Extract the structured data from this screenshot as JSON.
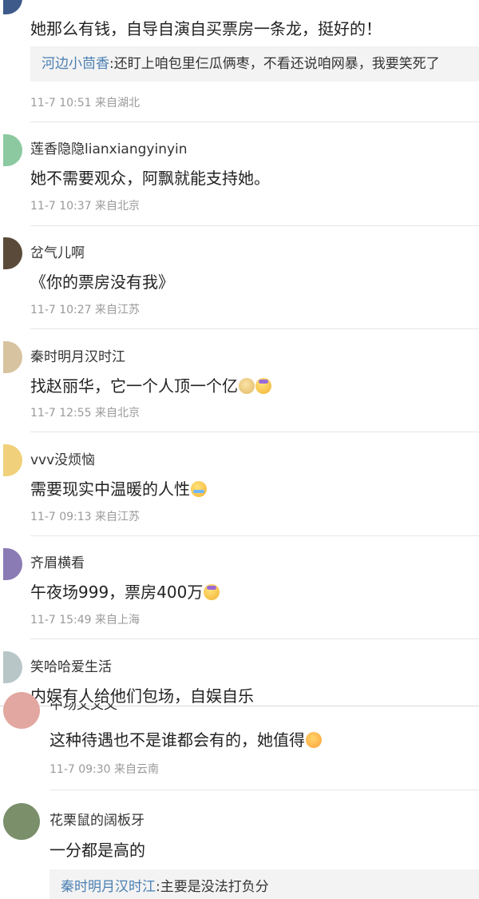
{
  "comments": [
    {
      "text": "她那么有钱，自导自演自买票房一条龙，挺好的！",
      "reply": {
        "name": "河边小茴香",
        "text": ":还盯上咱包里仨瓜俩枣，不看还说咱网暴，我要笑死了"
      },
      "meta": "11-7 10:51 来自湖北",
      "avatar_color": "#3d5a8a"
    },
    {
      "user": "莲香隐隐lianxiangyinyin",
      "text": "她不需要观众，阿飘就能支持她。",
      "meta": "11-7 10:37 来自北京",
      "avatar_color": "#8cc9a0"
    },
    {
      "user": "岔气儿啊",
      "text": "《你的票房没有我》",
      "meta": "11-7 10:27 来自江苏",
      "avatar_color": "#5a4a3a"
    },
    {
      "user": "秦时明月汉时江",
      "text": "找赵丽华，它一个人顶一个亿",
      "emojis": [
        "doge-emoji",
        "fear-emoji"
      ],
      "meta": "11-7 12:55 来自北京",
      "avatar_color": "#d8c3a0"
    },
    {
      "user": "vvv没烦恼",
      "text": "需要现实中温暖的人性",
      "emojis": [
        "cry-emoji"
      ],
      "meta": "11-7 09:13 来自江苏",
      "avatar_color": "#f0d07a"
    },
    {
      "user": "齐眉横看",
      "text": "午夜场999，票房400万",
      "emojis": [
        "fear-emoji"
      ],
      "meta": "11-7 15:49 来自上海",
      "avatar_color": "#8a7bb5"
    },
    {
      "user": "笑哈哈爱生活",
      "text": "内娱有人给他们包场，自娱自乐",
      "avatar_color": "#b8c6c8"
    },
    {
      "user_cut": "中场文文文",
      "text": "这种待遇也不是谁都会有的，她值得",
      "emojis": [
        "shock-emoji"
      ],
      "meta": "11-7 09:30 来自云南",
      "avatar_color": "#e2a7a0"
    },
    {
      "user": "花栗鼠的阔板牙",
      "text": "一分都是高的",
      "reply": {
        "name": "秦时明月汉时江",
        "text": ":主要是没法打负分"
      },
      "avatar_color": "#7a8f6a"
    }
  ]
}
